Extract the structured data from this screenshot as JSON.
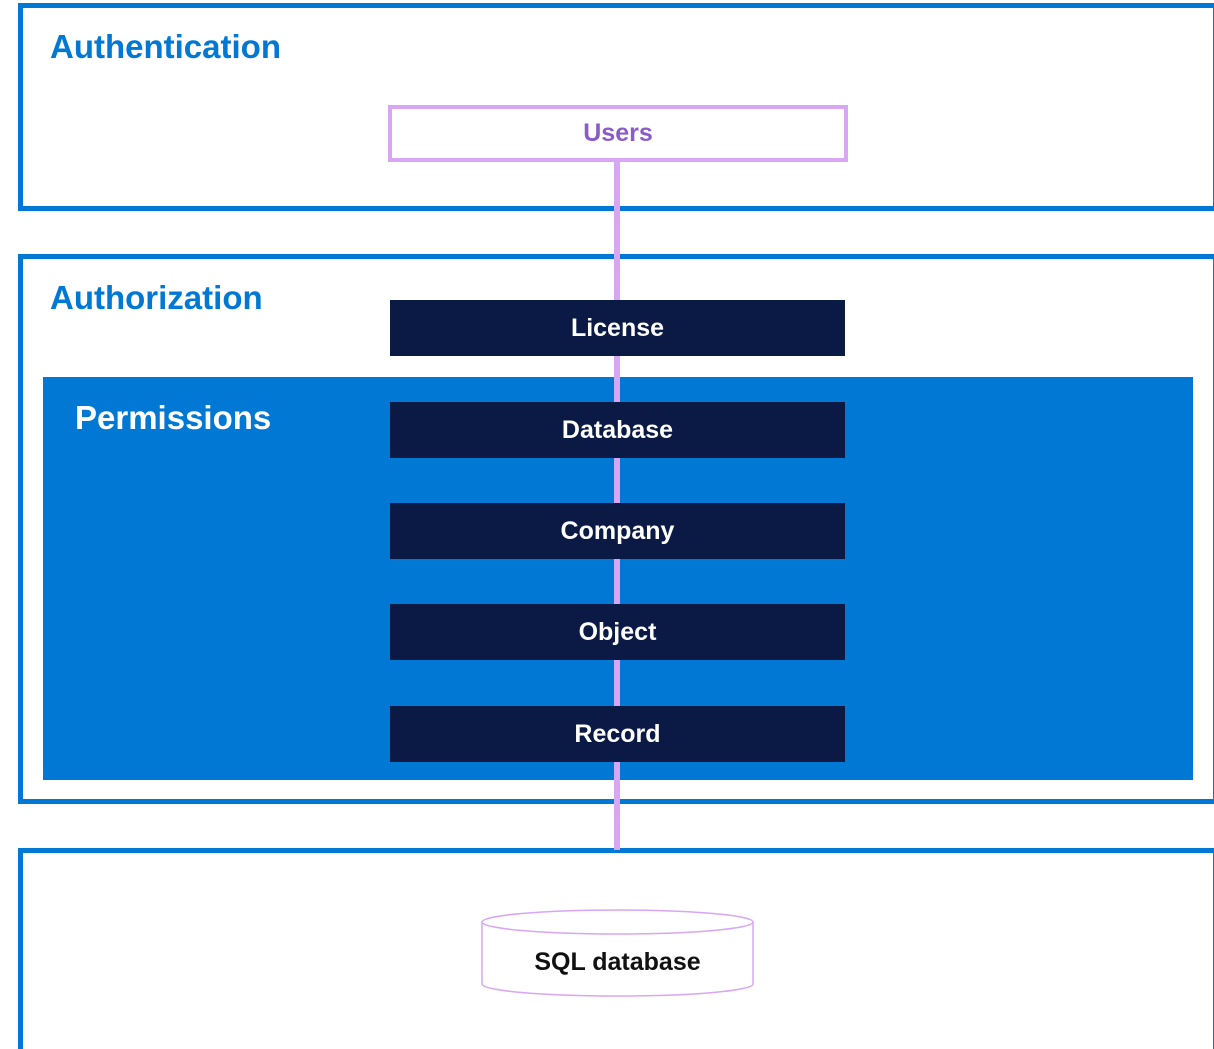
{
  "authentication": {
    "title": "Authentication",
    "users_label": "Users"
  },
  "authorization": {
    "title": "Authorization",
    "license_label": "License",
    "permissions": {
      "title": "Permissions",
      "layers": [
        "Database",
        "Company",
        "Object",
        "Record"
      ]
    }
  },
  "storage": {
    "database_label": "SQL database"
  },
  "colors": {
    "section_border": "#0078d4",
    "permissions_fill": "#0078d4",
    "layer_fill": "#0b1a45",
    "connector": "#d9a6f5",
    "users_text": "#8a5cc9"
  }
}
